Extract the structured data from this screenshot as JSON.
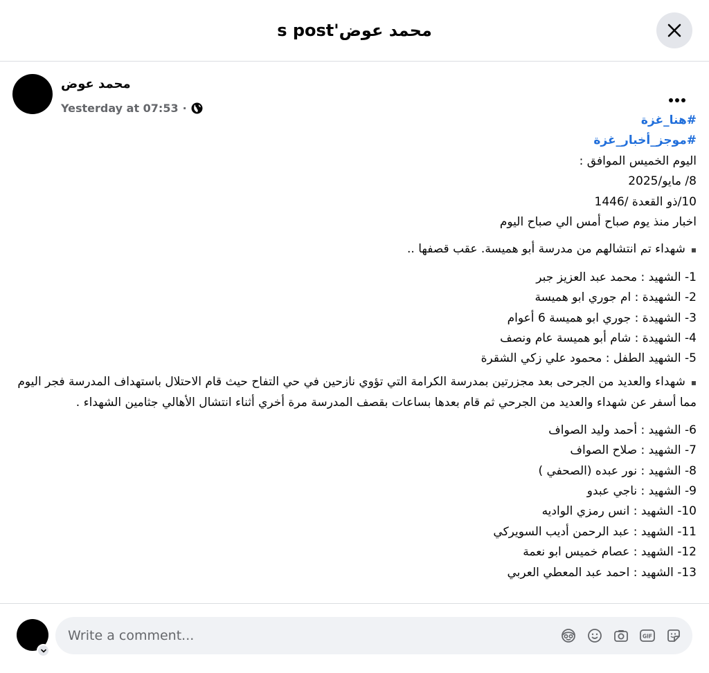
{
  "header": {
    "title": "محمد عوض's post",
    "close_icon": "close-icon"
  },
  "post": {
    "author": "محمد عوض",
    "time": "Yesterday at 07:53",
    "separator": "·",
    "privacy_icon": "globe-icon",
    "more_icon": "more-horizontal-icon",
    "hashtags": [
      "#هنا_غزة",
      "#موجز_أخبار_غزة"
    ],
    "intro_lines": [
      "اليوم الخميس الموافق :",
      "8/ مايو/2025",
      "10/ذو القعدة /1446",
      "اخبار منذ يوم صباح أمس الي صباح اليوم"
    ],
    "bullet_marker": "▪",
    "section1_title": "شهداء تم انتشالهم من مدرسة أبو هميسة. عقب قصفها ..",
    "section1_list": [
      "1- الشهيد : محمد عبد العزيز جبر",
      "2- الشهيدة : ام جوري ابو هميسة",
      "3- الشهيدة : جوري ابو هميسة 6 أعوام",
      "4- الشهيدة : شام أبو هميسة عام ونصف",
      "5- الشهيد الطفل : محمود علي زكي الشقرة"
    ],
    "section2_text": "شهداء  والعديد من الجرحى بعد مجزرتين بمدرسة الكرامة التي تؤوي نازحين في حي التفاح حيث قام الاحتلال باستهداف المدرسة فجر اليوم مما أسفر عن شهداء والعديد من الجرحي ثم قام بعدها بساعات بقصف المدرسة مرة أخري أثناء انتشال الأهالي جثامين الشهداء .",
    "section2_list": [
      "6- الشهيد : أحمد وليد الصواف",
      "7- الشهيد : صلاح الصواف",
      "8- الشهيد  :  نور عبده (الصحفي )",
      "9- الشهيد : ناجي عبدو",
      "10- الشهيد : انس رمزي الواديه",
      "11- الشهيد : عبد الرحمن أديب السويركي",
      "12- الشهيد :  عصام خميس ابو نعمة",
      "13- الشهيد :  احمد عبد المعطي العربي"
    ]
  },
  "comment": {
    "placeholder": "Write a comment...",
    "icons": [
      "avatar-sticker-icon",
      "emoji-icon",
      "camera-icon",
      "gif-icon",
      "sticker-icon"
    ]
  },
  "colors": {
    "hashtag": "#216fdb",
    "secondary_text": "#65676b",
    "close_bg": "#e4e6eb",
    "comment_bg": "#f0f2f5"
  }
}
